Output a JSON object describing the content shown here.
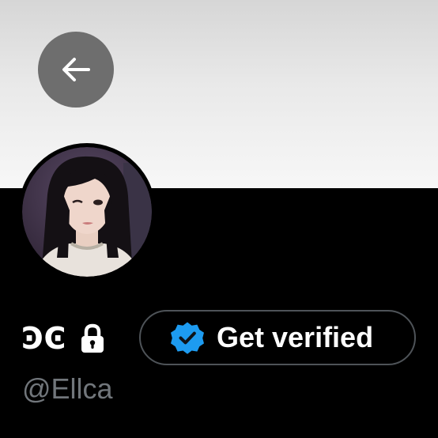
{
  "profile": {
    "display_name": "ϿϾ",
    "handle": "@Ellca",
    "protected": true,
    "avatar": "profile-photo"
  },
  "header": {
    "back_icon": "arrow-left-icon",
    "banner_color": "#e6e6e6"
  },
  "verify": {
    "label": "Get verified",
    "badge_icon": "verified-badge-icon",
    "badge_color": "#1d9bf0"
  },
  "colors": {
    "background": "#000000",
    "text": "#ffffff",
    "muted": "#71767b",
    "button_border": "#4e5358"
  }
}
